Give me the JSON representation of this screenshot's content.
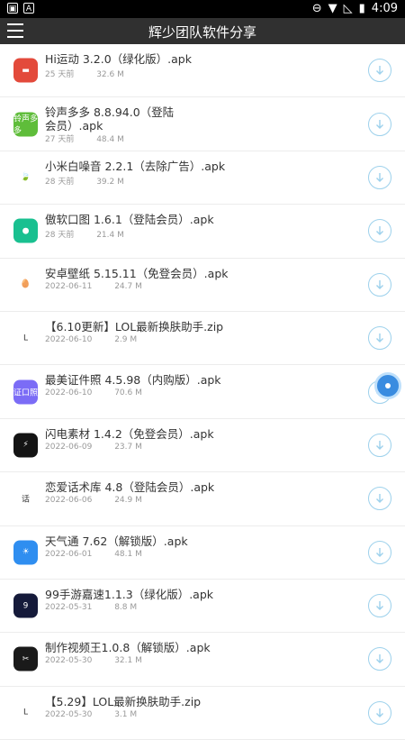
{
  "status": {
    "time": "4:09"
  },
  "appbar": {
    "title": "辉少团队软件分享"
  },
  "colors": {
    "appbar": "#303030",
    "download_ring": "#9dd1ec",
    "float": "#3a8ce0"
  },
  "items": [
    {
      "name": "Hi运动 3.2.0（绿化版）.apk",
      "date": "25 天前",
      "size": "32.6 M",
      "icon": "dumbbell-icon",
      "color": "#e34a3b",
      "glyph": "▬"
    },
    {
      "name": "铃声多多 8.8.94.0（登陆会员）.apk",
      "date": "27 天前",
      "size": "48.4 M",
      "icon": "ringtone-icon",
      "color": "#5fbd3a",
      "glyph": "铃声多多"
    },
    {
      "name": "小米白噪音 2.2.1（去除广告）.apk",
      "date": "28 天前",
      "size": "39.2 M",
      "icon": "leaf-icon",
      "color": "#ffffff",
      "glyph": "🍃"
    },
    {
      "name": "傲软口图 1.6.1（登陆会员）.apk",
      "date": "28 天前",
      "size": "21.4 M",
      "icon": "drop-icon",
      "color": "#19c090",
      "glyph": "●"
    },
    {
      "name": "安卓壁纸 5.15.11（免登会员）.apk",
      "date": "2022-06-11",
      "size": "24.7 M",
      "icon": "egg-icon",
      "color": "#ffffff",
      "glyph": "🥚"
    },
    {
      "name": "【6.10更新】LOL最新换肤助手.zip",
      "date": "2022-06-10",
      "size": "2.9 M",
      "icon": "lol-logo-icon",
      "color": "#ffffff",
      "glyph": "L"
    },
    {
      "name": "最美证件照 4.5.98（内购版）.apk",
      "date": "2022-06-10",
      "size": "70.6 M",
      "icon": "camera-icon",
      "color": "#7b6cf6",
      "glyph": "证口照"
    },
    {
      "name": "闪电素材 1.4.2（免登会员）.apk",
      "date": "2022-06-09",
      "size": "23.7 M",
      "icon": "lightning-icon",
      "color": "#141414",
      "glyph": "⚡"
    },
    {
      "name": "恋爱话术库 4.8（登陆会员）.apk",
      "date": "2022-06-06",
      "size": "24.9 M",
      "icon": "chat-library-icon",
      "color": "#ffffff",
      "glyph": "话"
    },
    {
      "name": "天气通 7.62（解锁版）.apk",
      "date": "2022-06-01",
      "size": "48.1 M",
      "icon": "weather-icon",
      "color": "#2f8ef0",
      "glyph": "☀"
    },
    {
      "name": "99手游嘉速1.1.3（绿化版）.apk",
      "date": "2022-05-31",
      "size": "8.8 M",
      "icon": "game-speed-icon",
      "color": "#151a3a",
      "glyph": "9"
    },
    {
      "name": "制作视频王1.0.8（解锁版）.apk",
      "date": "2022-05-30",
      "size": "32.1 M",
      "icon": "scissors-icon",
      "color": "#1a1a1a",
      "glyph": "✂"
    },
    {
      "name": "【5.29】LOL最新换肤助手.zip",
      "date": "2022-05-30",
      "size": "3.1 M",
      "icon": "lol-logo-icon",
      "color": "#ffffff",
      "glyph": "L"
    }
  ]
}
